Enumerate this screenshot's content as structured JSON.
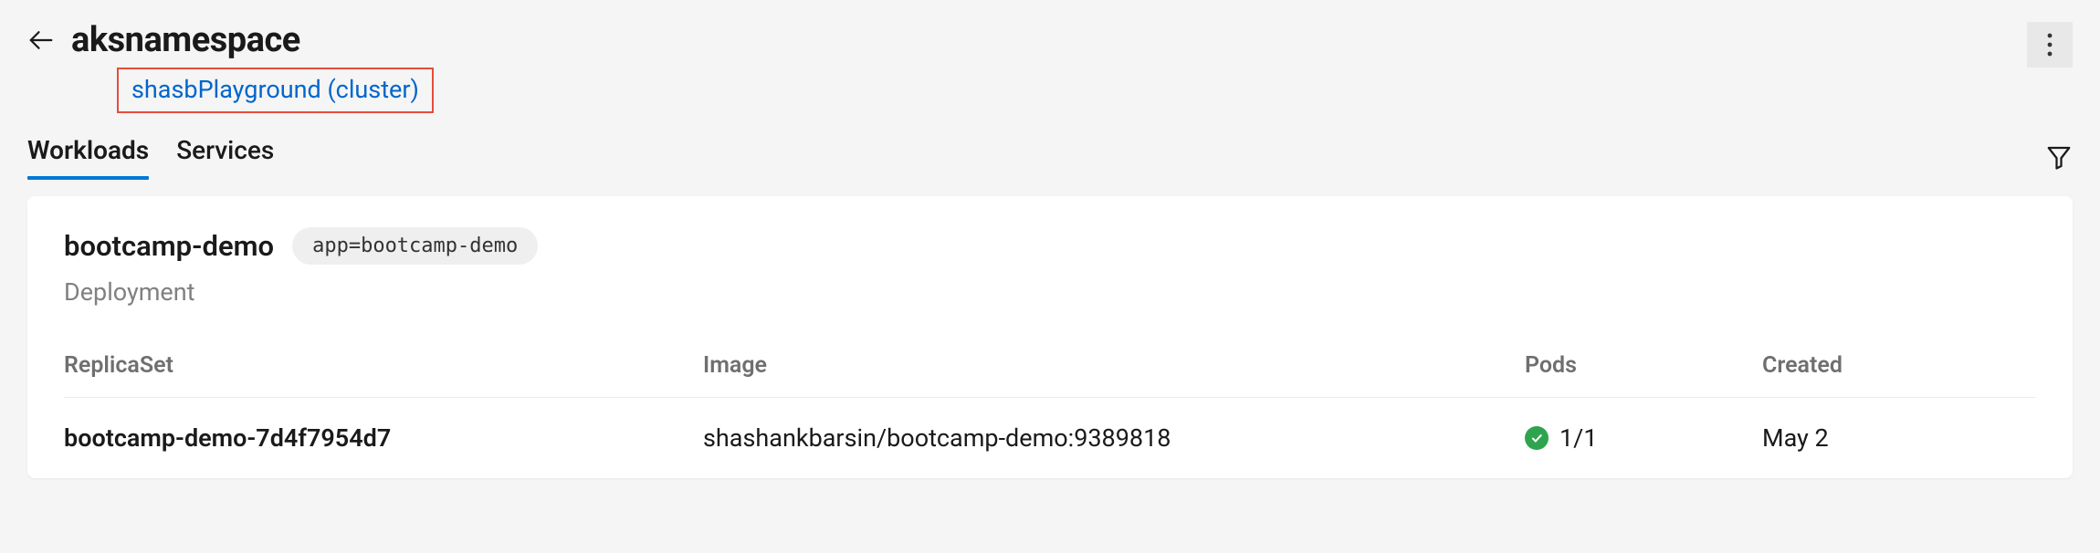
{
  "header": {
    "title": "aksnamespace",
    "cluster_link": "shasbPlayground (cluster)"
  },
  "tabs": {
    "workloads": "Workloads",
    "services": "Services"
  },
  "deployment": {
    "name": "bootcamp-demo",
    "label": "app=bootcamp-demo",
    "kind": "Deployment"
  },
  "table": {
    "headers": {
      "replicaset": "ReplicaSet",
      "image": "Image",
      "pods": "Pods",
      "created": "Created"
    },
    "rows": [
      {
        "replicaset": "bootcamp-demo-7d4f7954d7",
        "image": "shashankbarsin/bootcamp-demo:9389818",
        "pods": "1/1",
        "created": "May 2"
      }
    ]
  }
}
